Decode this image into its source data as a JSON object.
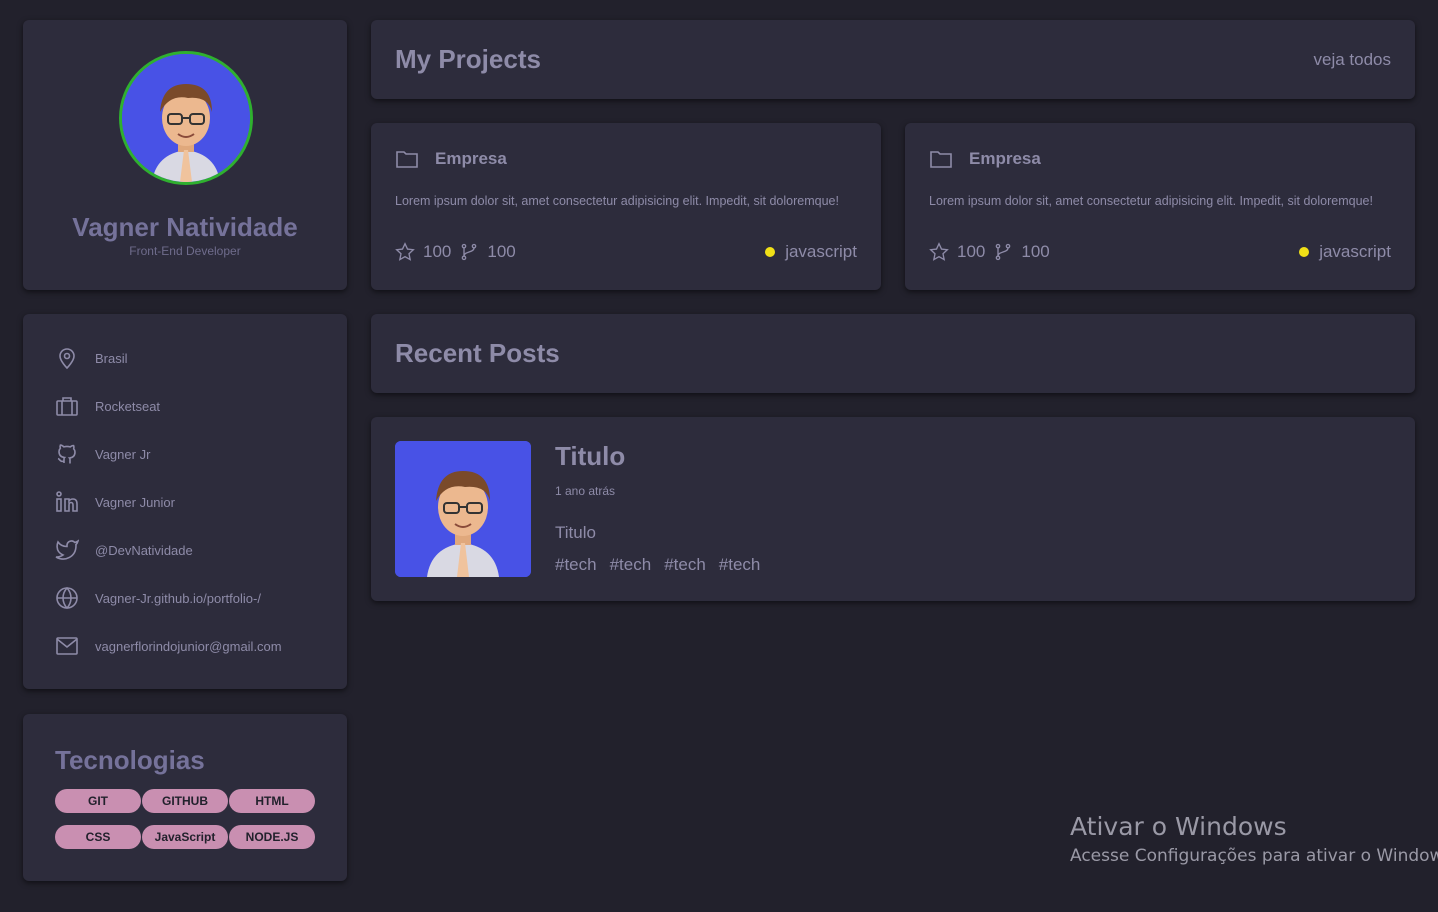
{
  "profile": {
    "name": "Vagner Natividade",
    "role": "Front-End Developer",
    "avatar_bg": "#4852e6",
    "avatar_border": "#2fb02f"
  },
  "info": [
    {
      "icon": "map-pin-icon",
      "text": "Brasil"
    },
    {
      "icon": "briefcase-icon",
      "text": "Rocketseat"
    },
    {
      "icon": "github-icon",
      "text": "Vagner Jr"
    },
    {
      "icon": "linkedin-icon",
      "text": "Vagner Junior"
    },
    {
      "icon": "twitter-icon",
      "text": "@DevNatividade"
    },
    {
      "icon": "globe-icon",
      "text": "Vagner-Jr.github.io/portfolio-/"
    },
    {
      "icon": "mail-icon",
      "text": "vagnerflorindojunior@gmail.com"
    }
  ],
  "tech": {
    "title": "Tecnologias",
    "items": [
      "GIT",
      "GITHUB",
      "HTML",
      "CSS",
      "JavaScript",
      "NODE.JS"
    ],
    "pill_color": "#c98fb1"
  },
  "projects": {
    "title": "My Projects",
    "see_all": "veja todos",
    "items": [
      {
        "name": "Empresa",
        "description": "Lorem ipsum dolor sit, amet consectetur adipisicing elit. Impedit, sit doloremque!",
        "stars": "100",
        "forks": "100",
        "language": "javascript",
        "language_color": "#f0e017"
      },
      {
        "name": "Empresa",
        "description": "Lorem ipsum dolor sit, amet consectetur adipisicing elit. Impedit, sit doloremque!",
        "stars": "100",
        "forks": "100",
        "language": "javascript",
        "language_color": "#f0e017"
      }
    ]
  },
  "posts": {
    "title": "Recent Posts",
    "items": [
      {
        "title": "Titulo",
        "time": "1 ano atrás",
        "subtitle": "Titulo",
        "tags": [
          "#tech",
          "#tech",
          "#tech",
          "#tech"
        ]
      }
    ]
  },
  "watermark": {
    "title": "Ativar o Windows",
    "subtitle": "Acesse Configurações para ativar o Windows."
  }
}
